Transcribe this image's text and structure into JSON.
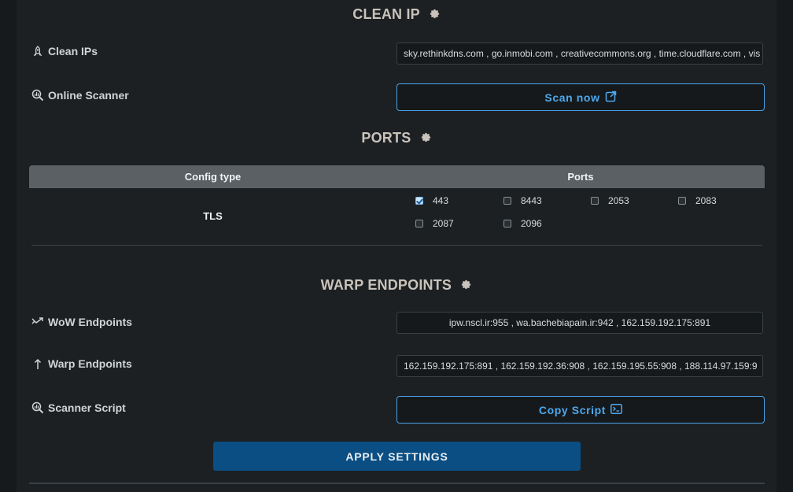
{
  "clean_ip": {
    "title": "CLEAN IP",
    "clean_ips_label": "Clean IPs",
    "clean_ips_value": "sky.rethinkdns.com , go.inmobi.com , creativecommons.org , time.cloudflare.com , vis",
    "online_scanner_label": "Online Scanner",
    "scan_button": "Scan now"
  },
  "ports": {
    "title": "PORTS",
    "headers": [
      "Config type",
      "Ports"
    ],
    "config_type": "TLS",
    "options": [
      {
        "port": "443",
        "checked": true
      },
      {
        "port": "8443",
        "checked": false
      },
      {
        "port": "2053",
        "checked": false
      },
      {
        "port": "2083",
        "checked": false
      },
      {
        "port": "2087",
        "checked": false
      },
      {
        "port": "2096",
        "checked": false
      }
    ]
  },
  "warp": {
    "title": "WARP ENDPOINTS",
    "wow_label": "WoW Endpoints",
    "wow_value": "ipw.nscl.ir:955 , wa.bachebiapain.ir:942 , 162.159.192.175:891",
    "warp_label": "Warp Endpoints",
    "warp_value": "162.159.192.175:891 , 162.159.192.36:908 , 162.159.195.55:908 , 188.114.97.159:9",
    "scanner_label": "Scanner Script",
    "copy_button": "Copy Script"
  },
  "apply_button": "APPLY SETTINGS",
  "colors": {
    "accent": "#4ea8ee",
    "apply_bg": "#0b4e83",
    "background": "#1c2023"
  },
  "icons": {
    "section": "gear-icon",
    "clean_ips": "rocket-icon",
    "scanner": "magnifier-chart-icon",
    "wow": "split-arrow-icon",
    "warp": "arrow-up-icon",
    "scan": "external-link-icon",
    "copy": "terminal-icon"
  }
}
